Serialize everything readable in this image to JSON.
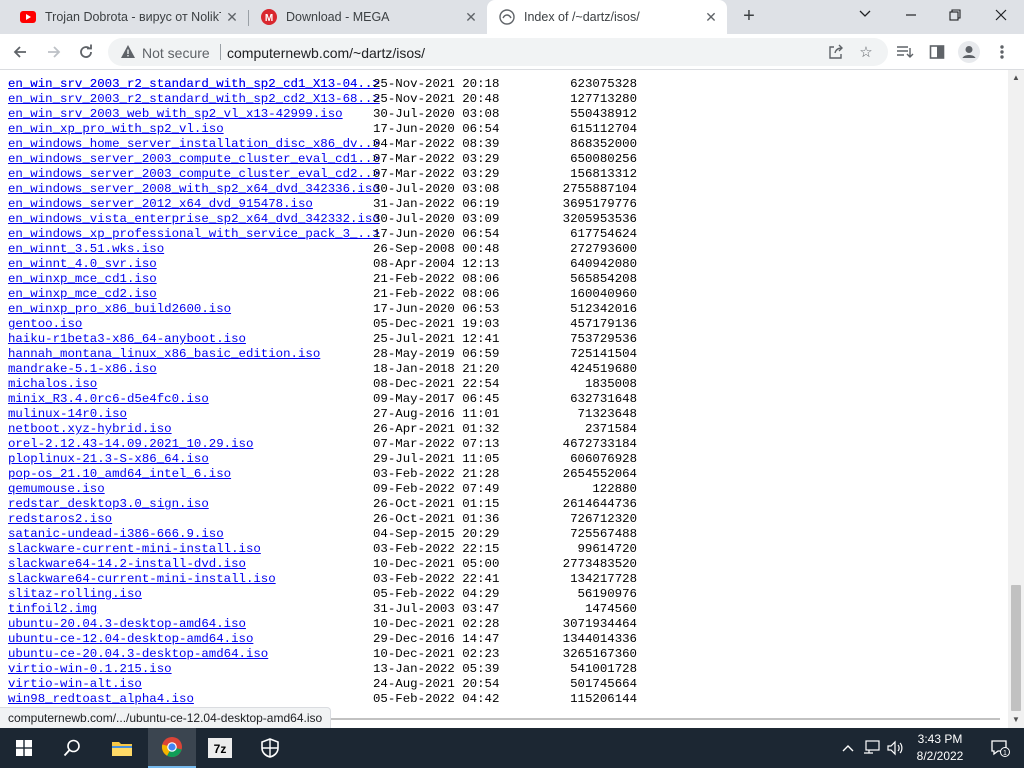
{
  "tabs": [
    {
      "title": "Trojan Dobrota - вирус от NolikTV",
      "icon": "youtube-icon"
    },
    {
      "title": "Download - MEGA",
      "icon": "mega-icon"
    },
    {
      "title": "Index of /~dartz/isos/",
      "icon": "page-icon",
      "active": true
    }
  ],
  "toolbar": {
    "not_secure": "Not secure",
    "url": "computernewb.com/~dartz/isos/"
  },
  "files": [
    {
      "name": "en_win_srv_2003_r2_standard_with_sp2_cd1_X13-04..>",
      "date": "25-Nov-2021 20:18",
      "size": "623075328"
    },
    {
      "name": "en_win_srv_2003_r2_standard_with_sp2_cd2_X13-68..>",
      "date": "25-Nov-2021 20:48",
      "size": "127713280"
    },
    {
      "name": "en_win_srv_2003_web_with_sp2_vl_x13-42999.iso",
      "date": "30-Jul-2020 03:08",
      "size": "550438912"
    },
    {
      "name": "en_win_xp_pro_with_sp2_vl.iso",
      "date": "17-Jun-2020 06:54",
      "size": "615112704"
    },
    {
      "name": "en_windows_home_server_installation_disc_x86_dv..>",
      "date": "04-Mar-2022 08:39",
      "size": "868352000"
    },
    {
      "name": "en_windows_server_2003_compute_cluster_eval_cd1..>",
      "date": "07-Mar-2022 03:29",
      "size": "650080256"
    },
    {
      "name": "en_windows_server_2003_compute_cluster_eval_cd2..>",
      "date": "07-Mar-2022 03:29",
      "size": "156813312"
    },
    {
      "name": "en_windows_server_2008_with_sp2_x64_dvd_342336.iso",
      "date": "30-Jul-2020 03:08",
      "size": "2755887104"
    },
    {
      "name": "en_windows_server_2012_x64_dvd_915478.iso",
      "date": "31-Jan-2022 06:19",
      "size": "3695179776"
    },
    {
      "name": "en_windows_vista_enterprise_sp2_x64_dvd_342332.iso",
      "date": "30-Jul-2020 03:09",
      "size": "3205953536"
    },
    {
      "name": "en_windows_xp_professional_with_service_pack_3_..>",
      "date": "17-Jun-2020 06:54",
      "size": "617754624"
    },
    {
      "name": "en_winnt_3.51.wks.iso",
      "date": "26-Sep-2008 00:48",
      "size": "272793600"
    },
    {
      "name": "en_winnt_4.0_svr.iso",
      "date": "08-Apr-2004 12:13",
      "size": "640942080"
    },
    {
      "name": "en_winxp_mce_cd1.iso",
      "date": "21-Feb-2022 08:06",
      "size": "565854208"
    },
    {
      "name": "en_winxp_mce_cd2.iso",
      "date": "21-Feb-2022 08:06",
      "size": "160040960"
    },
    {
      "name": "en_winxp_pro_x86_build2600.iso",
      "date": "17-Jun-2020 06:53",
      "size": "512342016"
    },
    {
      "name": "gentoo.iso",
      "date": "05-Dec-2021 19:03",
      "size": "457179136"
    },
    {
      "name": "haiku-r1beta3-x86_64-anyboot.iso",
      "date": "25-Jul-2021 12:41",
      "size": "753729536"
    },
    {
      "name": "hannah_montana_linux_x86_basic_edition.iso",
      "date": "28-May-2019 06:59",
      "size": "725141504"
    },
    {
      "name": "mandrake-5.1-x86.iso",
      "date": "18-Jan-2018 21:20",
      "size": "424519680"
    },
    {
      "name": "michalos.iso",
      "date": "08-Dec-2021 22:54",
      "size": "1835008"
    },
    {
      "name": "minix_R3.4.0rc6-d5e4fc0.iso",
      "date": "09-May-2017 06:45",
      "size": "632731648"
    },
    {
      "name": "mulinux-14r0.iso",
      "date": "27-Aug-2016 11:01",
      "size": "71323648"
    },
    {
      "name": "netboot.xyz-hybrid.iso",
      "date": "26-Apr-2021 01:32",
      "size": "2371584"
    },
    {
      "name": "orel-2.12.43-14.09.2021_10.29.iso",
      "date": "07-Mar-2022 07:13",
      "size": "4672733184"
    },
    {
      "name": "ploplinux-21.3-S-x86_64.iso",
      "date": "29-Jul-2021 11:05",
      "size": "606076928"
    },
    {
      "name": "pop-os_21.10_amd64_intel_6.iso",
      "date": "03-Feb-2022 21:28",
      "size": "2654552064"
    },
    {
      "name": "qemumouse.iso",
      "date": "09-Feb-2022 07:49",
      "size": "122880"
    },
    {
      "name": "redstar_desktop3.0_sign.iso",
      "date": "26-Oct-2021 01:15",
      "size": "2614644736"
    },
    {
      "name": "redstaros2.iso",
      "date": "26-Oct-2021 01:36",
      "size": "726712320"
    },
    {
      "name": "satanic-undead-i386-666.9.iso",
      "date": "04-Sep-2015 20:29",
      "size": "725567488"
    },
    {
      "name": "slackware-current-mini-install.iso",
      "date": "03-Feb-2022 22:15",
      "size": "99614720"
    },
    {
      "name": "slackware64-14.2-install-dvd.iso",
      "date": "10-Dec-2021 05:00",
      "size": "2773483520"
    },
    {
      "name": "slackware64-current-mini-install.iso",
      "date": "03-Feb-2022 22:41",
      "size": "134217728"
    },
    {
      "name": "slitaz-rolling.iso",
      "date": "05-Feb-2022 04:29",
      "size": "56190976"
    },
    {
      "name": "tinfoil2.img",
      "date": "31-Jul-2003 03:47",
      "size": "1474560"
    },
    {
      "name": "ubuntu-20.04.3-desktop-amd64.iso",
      "date": "10-Dec-2021 02:28",
      "size": "3071934464"
    },
    {
      "name": "ubuntu-ce-12.04-desktop-amd64.iso",
      "date": "29-Dec-2016 14:47",
      "size": "1344014336"
    },
    {
      "name": "ubuntu-ce-20.04.3-desktop-amd64.iso",
      "date": "10-Dec-2021 02:23",
      "size": "3265167360"
    },
    {
      "name": "virtio-win-0.1.215.iso",
      "date": "13-Jan-2022 05:39",
      "size": "541001728"
    },
    {
      "name": "virtio-win-alt.iso",
      "date": "24-Aug-2021 20:54",
      "size": "501745664"
    },
    {
      "name": "win98_redtoast_alpha4.iso",
      "date": "05-Feb-2022 04:42",
      "size": "115206144"
    }
  ],
  "statusbar": {
    "text": "computernewb.com/.../ubuntu-ce-12.04-desktop-amd64.iso"
  },
  "taskbar": {
    "time": "3:43 PM",
    "date": "8/2/2022",
    "notification_count": "1"
  },
  "colors": {
    "link": "#0000ee",
    "tabstrip": "#dee1e6",
    "taskbar": "#1c2733"
  }
}
